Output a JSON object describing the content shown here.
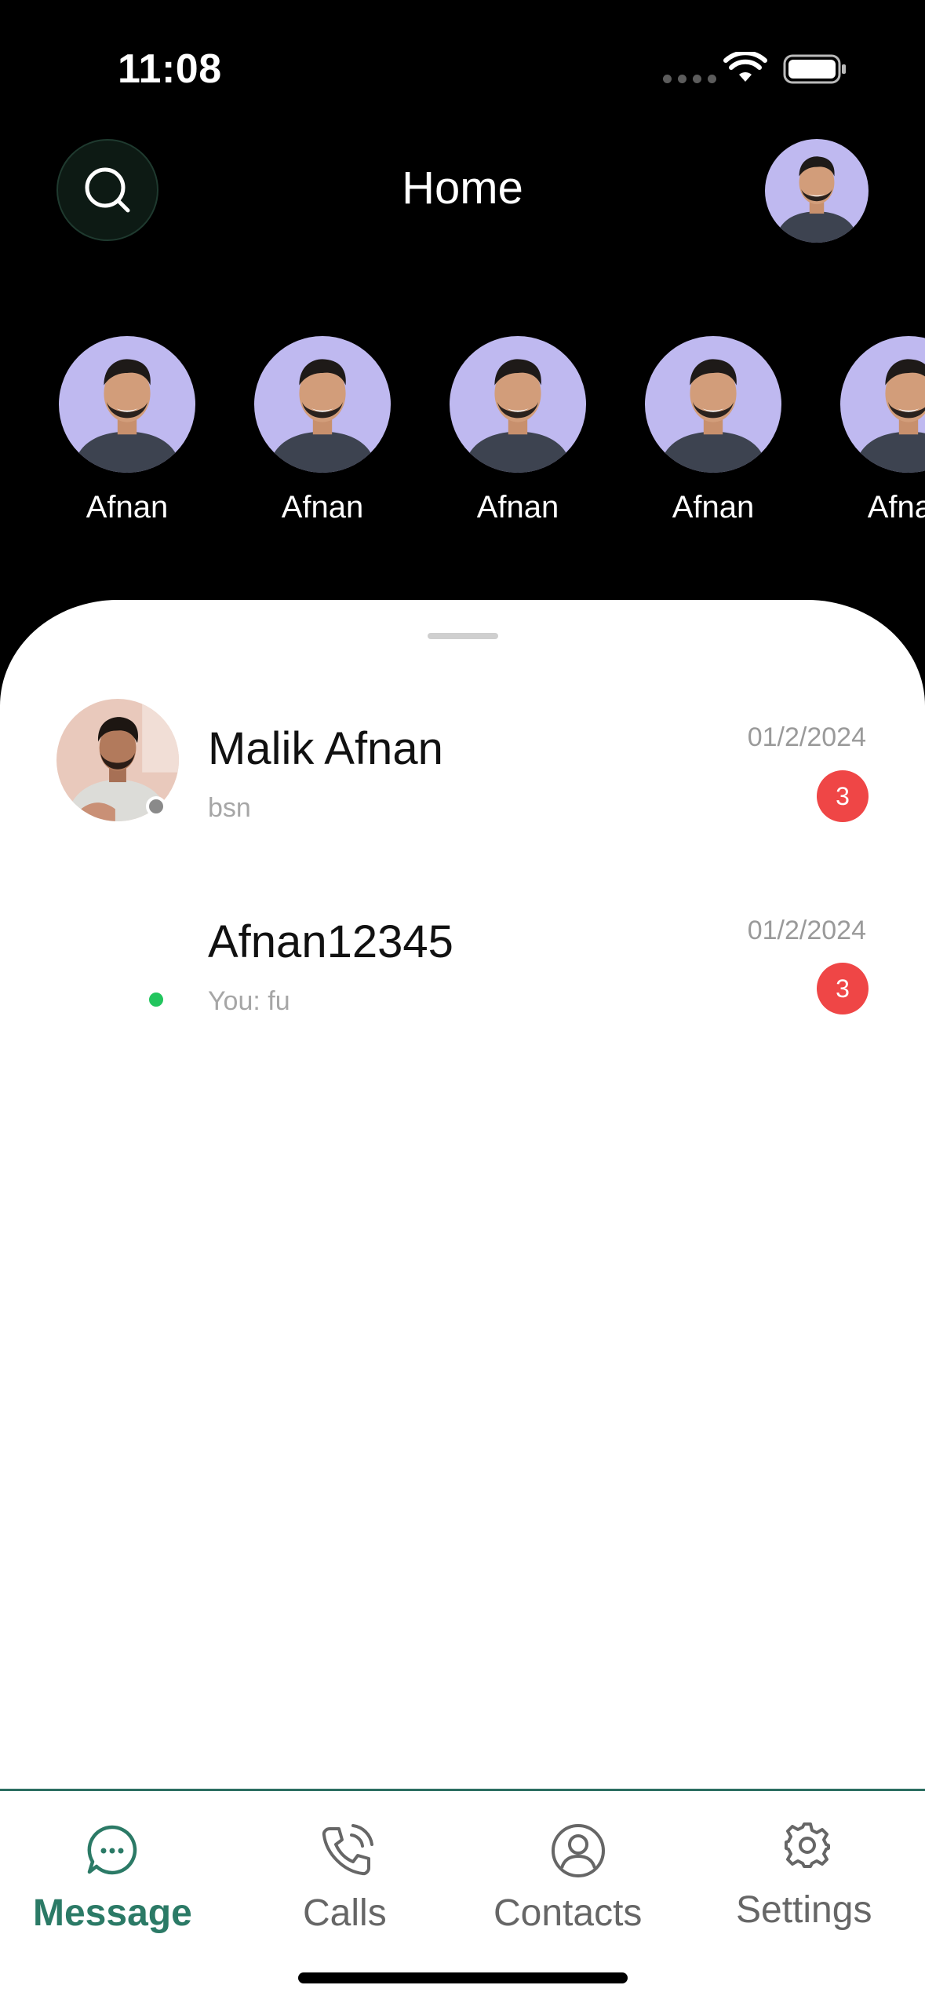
{
  "status_bar": {
    "time": "11:08"
  },
  "header": {
    "title": "Home"
  },
  "stories": [
    {
      "name": "Afnan"
    },
    {
      "name": "Afnan"
    },
    {
      "name": "Afnan"
    },
    {
      "name": "Afnan"
    },
    {
      "name": "Afnan"
    }
  ],
  "chats": [
    {
      "name": "Malik Afnan",
      "preview": "bsn",
      "date": "01/2/2024",
      "unread": "3",
      "status_color": "#8a8a8a"
    },
    {
      "name": "Afnan12345",
      "preview": "You: fu",
      "date": "01/2/2024",
      "unread": "3",
      "status_color": "#22c55e"
    }
  ],
  "bottom_nav": {
    "items": [
      {
        "label": "Message",
        "icon": "message-icon",
        "active": true
      },
      {
        "label": "Calls",
        "icon": "phone-icon",
        "active": false
      },
      {
        "label": "Contacts",
        "icon": "contact-icon",
        "active": false
      },
      {
        "label": "Settings",
        "icon": "gear-icon",
        "active": false
      }
    ]
  },
  "colors": {
    "accent": "#2b7a66",
    "badge": "#ef4646",
    "inactive_nav": "#666666"
  }
}
